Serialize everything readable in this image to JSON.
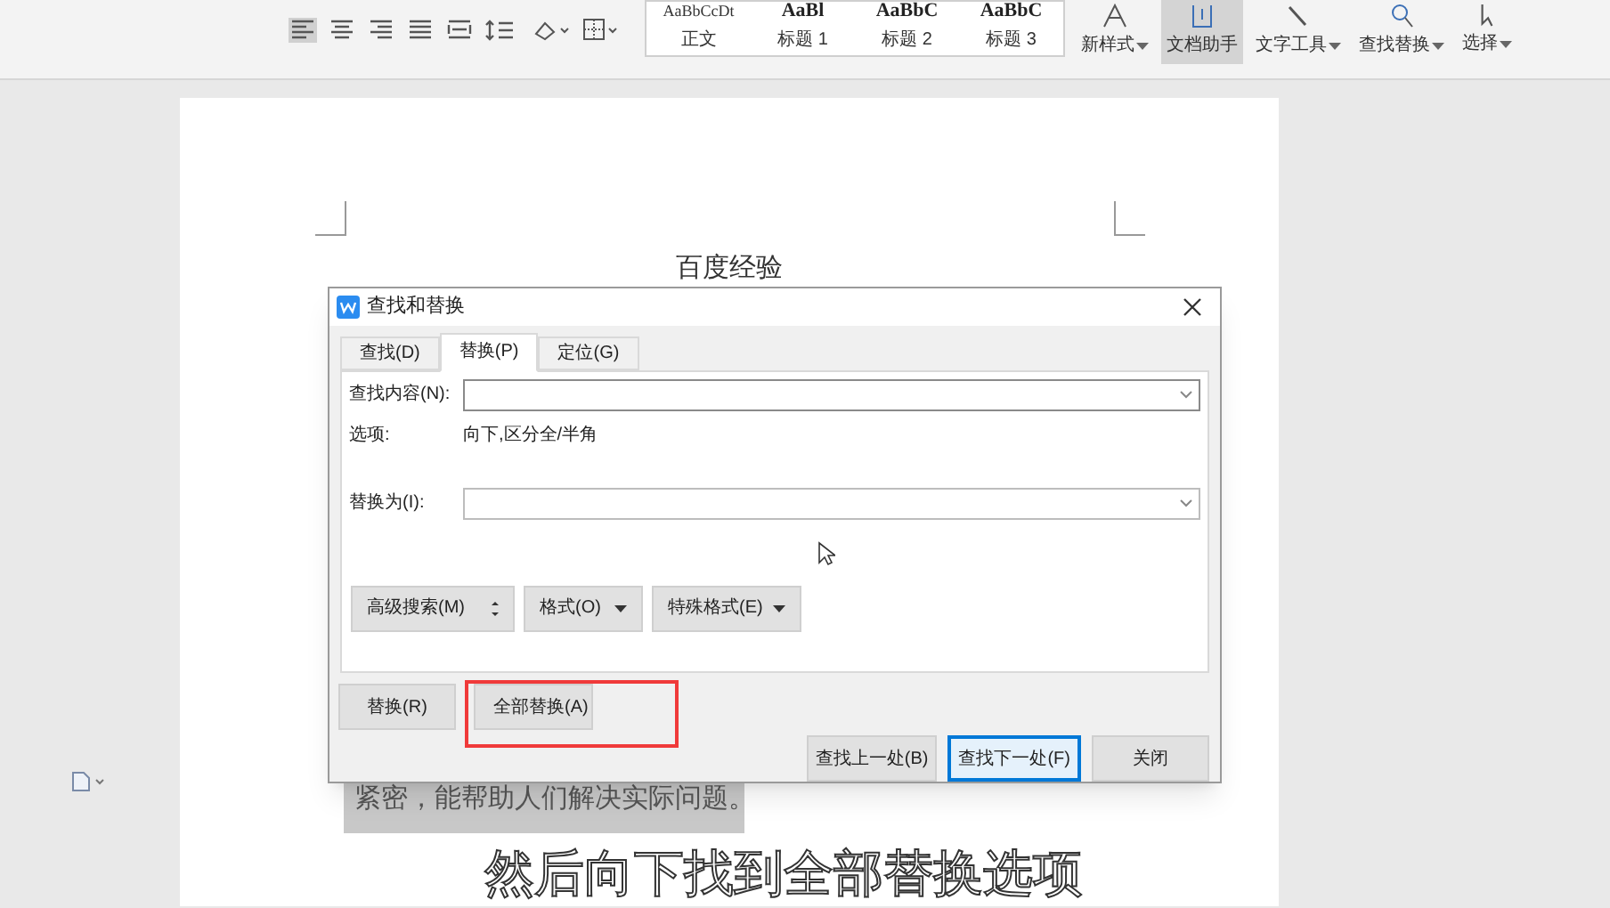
{
  "ribbon": {
    "styles": [
      {
        "preview": "AaBbCcDt",
        "label": "正文"
      },
      {
        "preview": "AaBl",
        "label": "标题 1"
      },
      {
        "preview": "AaBbC",
        "label": "标题 2"
      },
      {
        "preview": "AaBbC",
        "label": "标题 3"
      }
    ],
    "buttons": [
      {
        "kind": "newstyle",
        "label": "新样式",
        "selected": false,
        "dropdown": true
      },
      {
        "kind": "assistant",
        "label": "文档助手",
        "selected": true,
        "dropdown": false
      },
      {
        "kind": "texttools",
        "label": "文字工具",
        "selected": false,
        "dropdown": true
      },
      {
        "kind": "find",
        "label": "查找替换",
        "selected": false,
        "dropdown": true
      },
      {
        "kind": "select",
        "label": "选择",
        "selected": false,
        "dropdown": true
      }
    ]
  },
  "document": {
    "title": "百度经验",
    "highlighted_text": "紧密，能帮助人们解决实际问题。"
  },
  "dialog": {
    "title": "查找和替换",
    "tabs": [
      {
        "label": "查找(D)",
        "selected": false
      },
      {
        "label": "替换(P)",
        "selected": true
      },
      {
        "label": "定位(G)",
        "selected": false
      }
    ],
    "find_label": "查找内容(N):",
    "options_label": "选项:",
    "options_value": "向下,区分全/半角",
    "replace_label": "替换为(I):",
    "format_buttons": [
      {
        "label": "高级搜索(M)",
        "kind": "more"
      },
      {
        "label": "格式(O)",
        "kind": "menu"
      },
      {
        "label": "特殊格式(E)",
        "kind": "menu"
      }
    ],
    "replace_buttons": [
      {
        "label": "替换(R)",
        "highlighted": false
      },
      {
        "label": "全部替换(A)",
        "highlighted": true
      }
    ],
    "bottom_buttons": [
      {
        "label": "查找上一处(B)",
        "selected": false
      },
      {
        "label": "查找下一处(F)",
        "selected": true
      },
      {
        "label": "关闭",
        "selected": false
      }
    ]
  },
  "caption": "然后向下找到全部替换选项"
}
